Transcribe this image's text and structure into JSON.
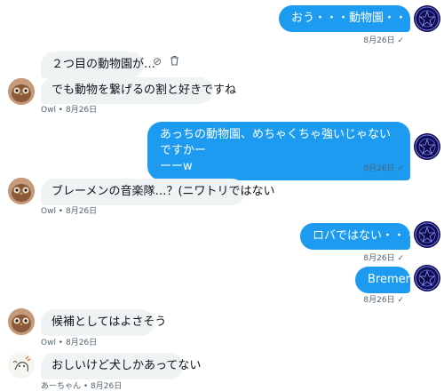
{
  "messages": [
    {
      "text": "おう・・・動物園・・・",
      "meta": "8月26日 ✓"
    },
    {
      "text": "２つ目の動物園が…"
    },
    {
      "text": "でも動物を繋げるの割と好きですね",
      "meta": "Owl • 8月26日"
    },
    {
      "text_line1": "あっちの動物園、めちゃくちゃ強いじゃないですかー",
      "text_line2": "ーーw",
      "meta": "8月26日 ✓"
    },
    {
      "text": "ブレーメンの音楽隊…？(ニワトリではない",
      "meta": "Owl • 8月26日"
    },
    {
      "text": "ロバではない・・・",
      "meta": "8月26日 ✓"
    },
    {
      "text": "Bremen",
      "meta": "8月26日 ✓"
    },
    {
      "text": "候補としてはよさそう",
      "meta": "Owl • 8月26日"
    },
    {
      "text": "おしいけど犬しかあってない",
      "meta": "あーちゃん • 8月26日"
    }
  ],
  "icons": {
    "block": "⊘",
    "trash": "🗑"
  },
  "colors": {
    "outgoing_bubble": "#1d9bf0",
    "incoming_bubble": "#eff3f4",
    "meta_text": "#536471"
  }
}
